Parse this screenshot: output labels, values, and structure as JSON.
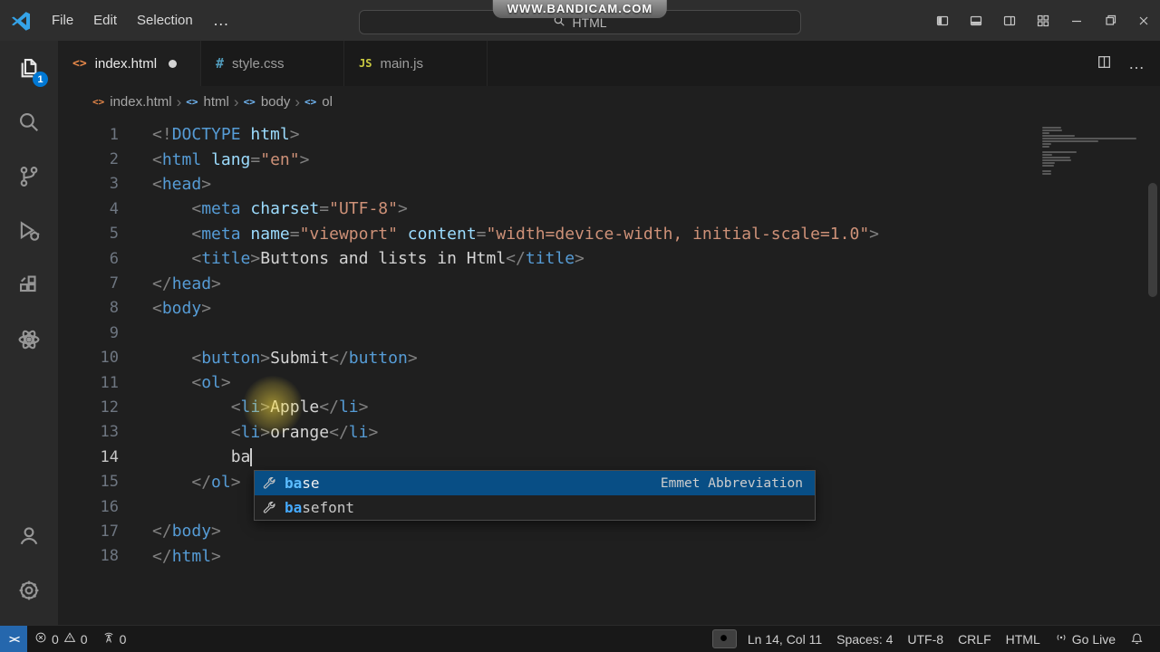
{
  "colors": {
    "accent": "#0078d4",
    "editor_background": "#1f1f1f",
    "tag": "#569cd6",
    "attribute": "#9cdcfe",
    "string": "#ce9178",
    "punctuation": "#808080",
    "plain_text": "#d4d4d4",
    "suggest_selected_background": "#084e85",
    "suggest_match": "#45aaff"
  },
  "icons": {
    "html_file": "<>",
    "css_file": "#",
    "js_file": "JS",
    "tag_symbol": "<>",
    "crumb_separator": "›",
    "remote": "><",
    "more": "…"
  },
  "titlebar": {
    "watermark": "WWW.BANDICAM.COM",
    "menus": [
      "File",
      "Edit",
      "Selection"
    ],
    "command_center_label": "HTML"
  },
  "activity_bar": {
    "explorer_badge": "1"
  },
  "tabs": [
    {
      "label": "index.html",
      "modified": true,
      "active": true
    },
    {
      "label": "style.css",
      "modified": false,
      "active": false
    },
    {
      "label": "main.js",
      "modified": false,
      "active": false
    }
  ],
  "breadcrumbs": [
    "index.html",
    "html",
    "body",
    "ol"
  ],
  "editor": {
    "cursor": {
      "line": 14,
      "col": 11
    },
    "lines": [
      {
        "tokens": [
          {
            "c": "p",
            "t": "<!"
          },
          {
            "c": "t",
            "t": "DOCTYPE"
          },
          {
            "c": "a",
            "t": " html"
          },
          {
            "c": "p",
            "t": ">"
          }
        ]
      },
      {
        "tokens": [
          {
            "c": "p",
            "t": "<"
          },
          {
            "c": "t",
            "t": "html"
          },
          {
            "c": "a",
            "t": " lang"
          },
          {
            "c": "p",
            "t": "="
          },
          {
            "c": "s",
            "t": "\"en\""
          },
          {
            "c": "p",
            "t": ">"
          }
        ]
      },
      {
        "tokens": [
          {
            "c": "p",
            "t": "<"
          },
          {
            "c": "t",
            "t": "head"
          },
          {
            "c": "p",
            "t": ">"
          }
        ]
      },
      {
        "tokens": [
          {
            "c": "x",
            "t": "    "
          },
          {
            "c": "p",
            "t": "<"
          },
          {
            "c": "t",
            "t": "meta"
          },
          {
            "c": "a",
            "t": " charset"
          },
          {
            "c": "p",
            "t": "="
          },
          {
            "c": "s",
            "t": "\"UTF-8\""
          },
          {
            "c": "p",
            "t": ">"
          }
        ]
      },
      {
        "tokens": [
          {
            "c": "x",
            "t": "    "
          },
          {
            "c": "p",
            "t": "<"
          },
          {
            "c": "t",
            "t": "meta"
          },
          {
            "c": "a",
            "t": " name"
          },
          {
            "c": "p",
            "t": "="
          },
          {
            "c": "s",
            "t": "\"viewport\""
          },
          {
            "c": "a",
            "t": " content"
          },
          {
            "c": "p",
            "t": "="
          },
          {
            "c": "s",
            "t": "\"width=device-width, initial-scale=1.0\""
          },
          {
            "c": "p",
            "t": ">"
          }
        ]
      },
      {
        "tokens": [
          {
            "c": "x",
            "t": "    "
          },
          {
            "c": "p",
            "t": "<"
          },
          {
            "c": "t",
            "t": "title"
          },
          {
            "c": "p",
            "t": ">"
          },
          {
            "c": "x",
            "t": "Buttons and lists in Html"
          },
          {
            "c": "p",
            "t": "</"
          },
          {
            "c": "t",
            "t": "title"
          },
          {
            "c": "p",
            "t": ">"
          }
        ]
      },
      {
        "tokens": [
          {
            "c": "p",
            "t": "</"
          },
          {
            "c": "t",
            "t": "head"
          },
          {
            "c": "p",
            "t": ">"
          }
        ]
      },
      {
        "tokens": [
          {
            "c": "p",
            "t": "<"
          },
          {
            "c": "t",
            "t": "body"
          },
          {
            "c": "p",
            "t": ">"
          }
        ]
      },
      {
        "tokens": []
      },
      {
        "tokens": [
          {
            "c": "x",
            "t": "    "
          },
          {
            "c": "p",
            "t": "<"
          },
          {
            "c": "t",
            "t": "button"
          },
          {
            "c": "p",
            "t": ">"
          },
          {
            "c": "x",
            "t": "Submit"
          },
          {
            "c": "p",
            "t": "</"
          },
          {
            "c": "t",
            "t": "button"
          },
          {
            "c": "p",
            "t": ">"
          }
        ]
      },
      {
        "tokens": [
          {
            "c": "x",
            "t": "    "
          },
          {
            "c": "p",
            "t": "<"
          },
          {
            "c": "t",
            "t": "ol"
          },
          {
            "c": "p",
            "t": ">"
          }
        ]
      },
      {
        "tokens": [
          {
            "c": "x",
            "t": "        "
          },
          {
            "c": "p",
            "t": "<"
          },
          {
            "c": "t",
            "t": "li"
          },
          {
            "c": "p",
            "t": ">"
          },
          {
            "c": "x",
            "t": "Apple"
          },
          {
            "c": "p",
            "t": "</"
          },
          {
            "c": "t",
            "t": "li"
          },
          {
            "c": "p",
            "t": ">"
          }
        ]
      },
      {
        "tokens": [
          {
            "c": "x",
            "t": "        "
          },
          {
            "c": "p",
            "t": "<"
          },
          {
            "c": "t",
            "t": "li"
          },
          {
            "c": "p",
            "t": ">"
          },
          {
            "c": "x",
            "t": "orange"
          },
          {
            "c": "p",
            "t": "</"
          },
          {
            "c": "t",
            "t": "li"
          },
          {
            "c": "p",
            "t": ">"
          }
        ]
      },
      {
        "tokens": [
          {
            "c": "x",
            "t": "        ba"
          }
        ]
      },
      {
        "tokens": [
          {
            "c": "x",
            "t": "    "
          },
          {
            "c": "p",
            "t": "</"
          },
          {
            "c": "t",
            "t": "ol"
          },
          {
            "c": "p",
            "t": ">"
          }
        ]
      },
      {
        "tokens": []
      },
      {
        "tokens": [
          {
            "c": "p",
            "t": "</"
          },
          {
            "c": "t",
            "t": "body"
          },
          {
            "c": "p",
            "t": ">"
          }
        ]
      },
      {
        "tokens": [
          {
            "c": "p",
            "t": "</"
          },
          {
            "c": "t",
            "t": "html"
          },
          {
            "c": "p",
            "t": ">"
          }
        ]
      }
    ]
  },
  "suggest": {
    "items": [
      {
        "label_match": "ba",
        "label_rest": "se",
        "detail": "Emmet Abbreviation",
        "selected": true
      },
      {
        "label_match": "ba",
        "label_rest": "sefont",
        "detail": "",
        "selected": false
      }
    ]
  },
  "statusbar": {
    "errors": "0",
    "warnings": "0",
    "ports": "0",
    "cursor_position": "Ln 14, Col 11",
    "indentation": "Spaces: 4",
    "encoding": "UTF-8",
    "eol": "CRLF",
    "language": "HTML",
    "go_live": "Go Live"
  }
}
